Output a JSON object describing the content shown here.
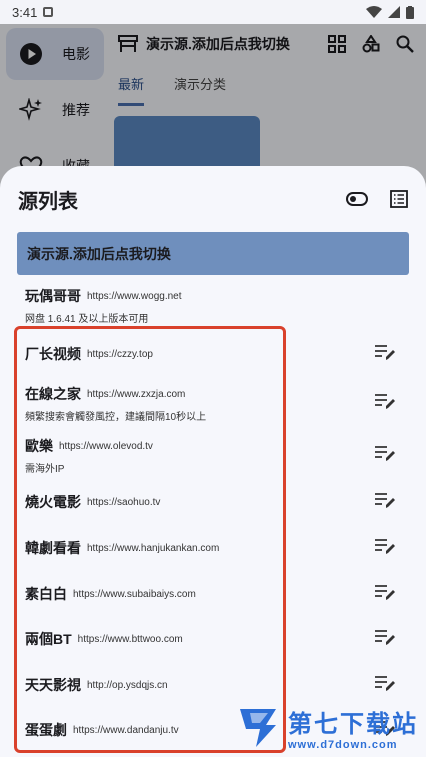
{
  "status": {
    "time": "3:41"
  },
  "app": {
    "nav": [
      {
        "label": "电影"
      },
      {
        "label": "推荐"
      },
      {
        "label": "收藏"
      }
    ],
    "topbar_title": "演示源.添加后点我切换",
    "tabs": [
      "最新",
      "演示分类"
    ]
  },
  "sheet": {
    "title": "源列表",
    "selected": "演示源.添加后点我切换",
    "sites": [
      {
        "name": "玩偶哥哥",
        "url": "https://www.wogg.net",
        "note": "网盘 1.6.41 及以上版本可用"
      },
      {
        "name": "厂长视频",
        "url": "https://czzy.top",
        "note": ""
      },
      {
        "name": "在線之家",
        "url": "https://www.zxzja.com",
        "note": "頻繁搜索會觸發風控，建議間隔10秒以上"
      },
      {
        "name": "歐樂",
        "url": "https://www.olevod.tv",
        "note": "需海外IP"
      },
      {
        "name": "燒火電影",
        "url": "https://saohuo.tv",
        "note": ""
      },
      {
        "name": "韓劇看看",
        "url": "https://www.hanjukankan.com",
        "note": ""
      },
      {
        "name": "素白白",
        "url": "https://www.subaibaiys.com",
        "note": ""
      },
      {
        "name": "兩個BT",
        "url": "https://www.bttwoo.com",
        "note": ""
      },
      {
        "name": "天天影視",
        "url": "http://op.ysdqjs.cn",
        "note": ""
      },
      {
        "name": "蛋蛋劇",
        "url": "https://www.dandanju.tv",
        "note": ""
      }
    ]
  },
  "watermark": {
    "main": "第七下载站",
    "sub": "www.d7down.com"
  },
  "colors": {
    "selected_bg": "#6f8fbd",
    "highlight": "#d9412c",
    "sheet_bg": "#f6f7fc"
  }
}
